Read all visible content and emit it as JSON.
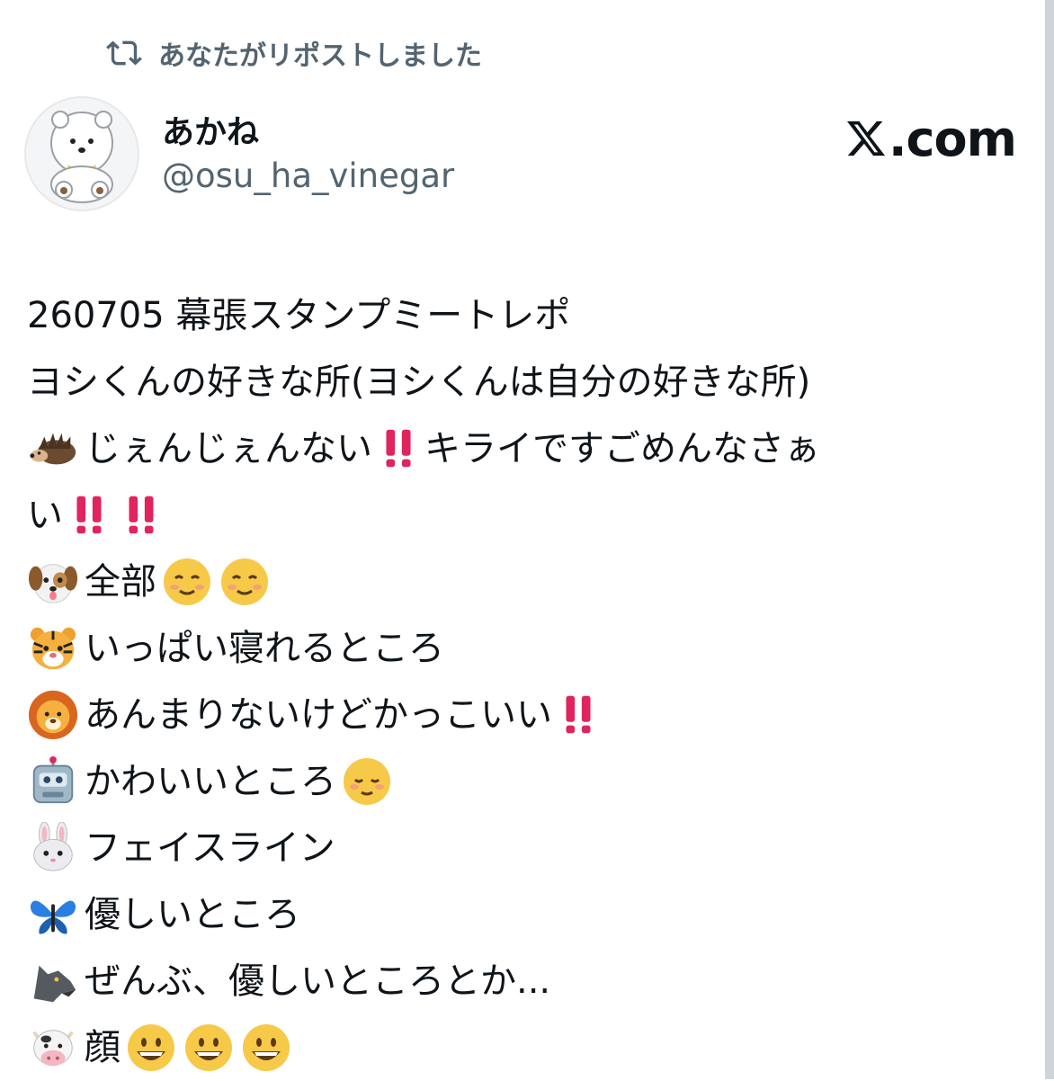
{
  "repost": {
    "label": "あなたがリポストしました",
    "icon": "repost-icon"
  },
  "author": {
    "name": "あかね",
    "handle": "@osu_ha_vinegar",
    "avatar": "avatar-bear-image"
  },
  "brand": {
    "label": ".com",
    "icon": "x-logo-icon"
  },
  "tweet": {
    "line1": "260705 幕張スタンプミートレポ",
    "line2": "ヨシくんの好きな所(ヨシくんは自分の好きな所)",
    "line3": "じぇんじぇんない",
    "line3b": "キライですごめんなさぁ",
    "line4": "い",
    "line5": "全部",
    "line6": "いっぱい寝れるところ",
    "line7": "あんまりないけどかっこいい",
    "line8": "かわいいところ",
    "line9": "フェイスライン",
    "line10": "優しいところ",
    "line11": "ぜんぶ、優しいところとか...",
    "line12": "顔"
  },
  "emoji": [
    "hedgehog-icon",
    "dog-icon",
    "tiger-icon",
    "lion-icon",
    "robot-icon",
    "rabbit-icon",
    "butterfly-icon",
    "wolf-icon",
    "cow-icon"
  ],
  "colors": {
    "text": "#0f1419",
    "muted": "#536471",
    "accent": "#e0245e"
  }
}
